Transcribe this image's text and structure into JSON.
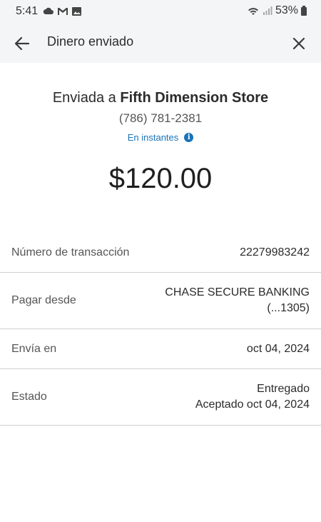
{
  "status_bar": {
    "time": "5:41",
    "battery": "53%"
  },
  "header": {
    "title": "Dinero enviado"
  },
  "summary": {
    "sent_to_prefix": "Enviada a",
    "recipient_name": "Fifth Dimension Store",
    "recipient_phone": "(786) 781-2381",
    "delivery_speed": "En instantes",
    "amount": "$120.00"
  },
  "details": [
    {
      "label": "Número de transacción",
      "value_lines": [
        "22279983242"
      ]
    },
    {
      "label": "Pagar desde",
      "value_lines": [
        "CHASE SECURE BANKING",
        "(...1305)"
      ]
    },
    {
      "label": "Envía en",
      "value_lines": [
        "oct 04, 2024"
      ]
    },
    {
      "label": "Estado",
      "value_lines": [
        "Entregado",
        "Aceptado oct 04, 2024"
      ]
    }
  ],
  "colors": {
    "accent": "#1a73b8",
    "header_bg": "#f4f5f7"
  }
}
